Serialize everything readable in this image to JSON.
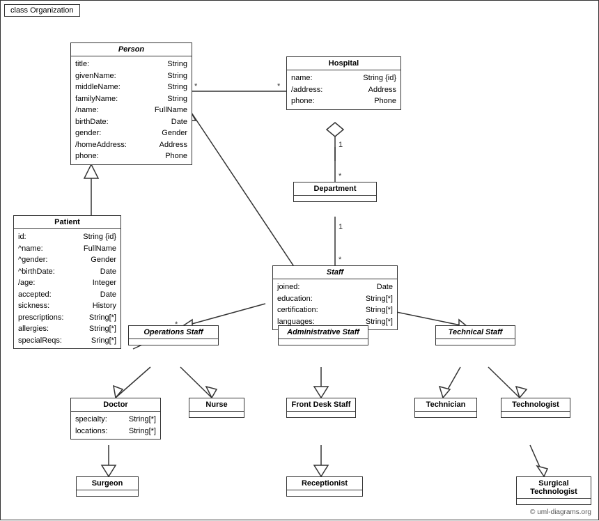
{
  "title": "class Organization",
  "copyright": "© uml-diagrams.org",
  "classes": {
    "person": {
      "name": "Person",
      "italic": true,
      "attrs": [
        {
          "name": "title:",
          "type": "String"
        },
        {
          "name": "givenName:",
          "type": "String"
        },
        {
          "name": "middleName:",
          "type": "String"
        },
        {
          "name": "familyName:",
          "type": "String"
        },
        {
          "name": "/name:",
          "type": "FullName"
        },
        {
          "name": "birthDate:",
          "type": "Date"
        },
        {
          "name": "gender:",
          "type": "Gender"
        },
        {
          "name": "/homeAddress:",
          "type": "Address"
        },
        {
          "name": "phone:",
          "type": "Phone"
        }
      ]
    },
    "hospital": {
      "name": "Hospital",
      "italic": false,
      "attrs": [
        {
          "name": "name:",
          "type": "String {id}"
        },
        {
          "name": "/address:",
          "type": "Address"
        },
        {
          "name": "phone:",
          "type": "Phone"
        }
      ]
    },
    "department": {
      "name": "Department",
      "italic": false,
      "attrs": []
    },
    "staff": {
      "name": "Staff",
      "italic": true,
      "attrs": [
        {
          "name": "joined:",
          "type": "Date"
        },
        {
          "name": "education:",
          "type": "String[*]"
        },
        {
          "name": "certification:",
          "type": "String[*]"
        },
        {
          "name": "languages:",
          "type": "String[*]"
        }
      ]
    },
    "patient": {
      "name": "Patient",
      "italic": false,
      "attrs": [
        {
          "name": "id:",
          "type": "String {id}"
        },
        {
          "name": "^name:",
          "type": "FullName"
        },
        {
          "name": "^gender:",
          "type": "Gender"
        },
        {
          "name": "^birthDate:",
          "type": "Date"
        },
        {
          "name": "/age:",
          "type": "Integer"
        },
        {
          "name": "accepted:",
          "type": "Date"
        },
        {
          "name": "sickness:",
          "type": "History"
        },
        {
          "name": "prescriptions:",
          "type": "String[*]"
        },
        {
          "name": "allergies:",
          "type": "String[*]"
        },
        {
          "name": "specialReqs:",
          "type": "Sring[*]"
        }
      ]
    },
    "operations_staff": {
      "name": "Operations Staff",
      "italic": true
    },
    "administrative_staff": {
      "name": "Administrative Staff",
      "italic": true
    },
    "technical_staff": {
      "name": "Technical Staff",
      "italic": true
    },
    "doctor": {
      "name": "Doctor",
      "italic": false,
      "attrs": [
        {
          "name": "specialty:",
          "type": "String[*]"
        },
        {
          "name": "locations:",
          "type": "String[*]"
        }
      ]
    },
    "nurse": {
      "name": "Nurse",
      "italic": false,
      "attrs": []
    },
    "front_desk_staff": {
      "name": "Front Desk Staff",
      "italic": false,
      "attrs": []
    },
    "technician": {
      "name": "Technician",
      "italic": false,
      "attrs": []
    },
    "technologist": {
      "name": "Technologist",
      "italic": false,
      "attrs": []
    },
    "surgeon": {
      "name": "Surgeon",
      "italic": false,
      "attrs": []
    },
    "receptionist": {
      "name": "Receptionist",
      "italic": false,
      "attrs": []
    },
    "surgical_technologist": {
      "name": "Surgical Technologist",
      "italic": false,
      "attrs": []
    }
  }
}
